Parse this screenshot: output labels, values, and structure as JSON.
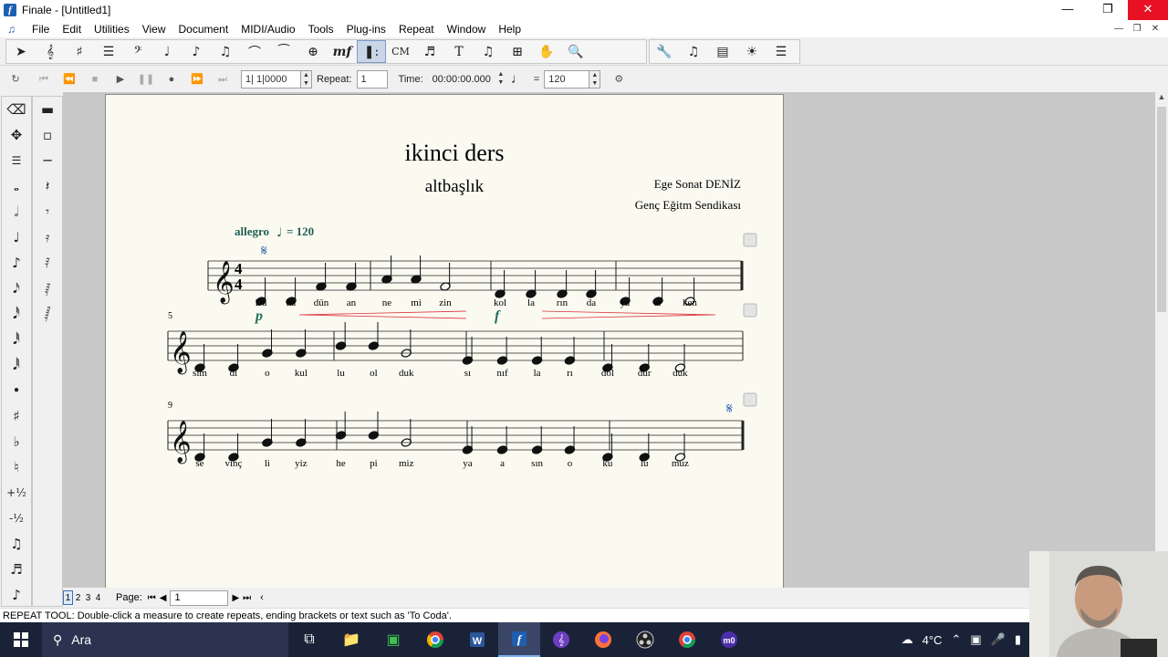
{
  "window": {
    "title": "Finale - [Untitled1]",
    "minimize": "—",
    "maximize": "❐",
    "close": "✕"
  },
  "menu": [
    "File",
    "Edit",
    "Utilities",
    "View",
    "Document",
    "MIDI/Audio",
    "Tools",
    "Plug-ins",
    "Repeat",
    "Window",
    "Help"
  ],
  "playback": {
    "counter": "1| 1|0000",
    "repeat_label": "Repeat:",
    "repeat_value": "1",
    "time_label": "Time:",
    "time_value": "00:00:00.000",
    "equals": "=",
    "tempo": "120"
  },
  "score": {
    "title": "ikinci ders",
    "subtitle": "altbaşlık",
    "composer": "Ege Sonat DENİZ",
    "copyright": "Genç Eğitm Sendikası",
    "tempo_marking_text": "allegro",
    "tempo_marking_value": "= 120",
    "time_signature": [
      "4",
      "4"
    ],
    "systems": [
      {
        "measure_number": "",
        "dynamics": [],
        "lyrics": [
          "Da",
          "ha",
          "dün",
          "an",
          "ne",
          "mi",
          "zin",
          "kol",
          "la",
          "rın",
          "da",
          "ya",
          "ar",
          "ken"
        ]
      },
      {
        "measure_number": "5",
        "dynamics": [
          "p",
          "f"
        ],
        "lyrics": [
          "sim",
          "di",
          "o",
          "kul",
          "lu",
          "ol",
          "duk",
          "sı",
          "nıf",
          "la",
          "rı",
          "dol",
          "dur",
          "duk"
        ]
      },
      {
        "measure_number": "9",
        "dynamics": [],
        "lyrics": [
          "se",
          "vinç",
          "li",
          "yiz",
          "he",
          "pi",
          "miz",
          "ya",
          "a",
          "sın",
          "o",
          "ku",
          "lu",
          "muz"
        ]
      }
    ]
  },
  "pagenav": {
    "tabs": [
      "1",
      "2",
      "3",
      "4"
    ],
    "page_label": "Page:",
    "page_value": "1"
  },
  "status": "REPEAT TOOL: Double-click a measure to create repeats, ending brackets or text such as 'To Coda'.",
  "taskbar": {
    "search_text": "Ara",
    "weather": "4°C"
  },
  "icons": [
    "finale-app-icon",
    "selection-tool-icon",
    "staff-tool-icon",
    "repeat-tool-icon",
    "text-tool-icon",
    "hand-grabber-icon",
    "zoom-icon",
    "play-icon",
    "record-icon",
    "settings-icon",
    "windows-start-icon",
    "search-icon",
    "chrome-icon",
    "word-icon",
    "firefox-icon"
  ]
}
